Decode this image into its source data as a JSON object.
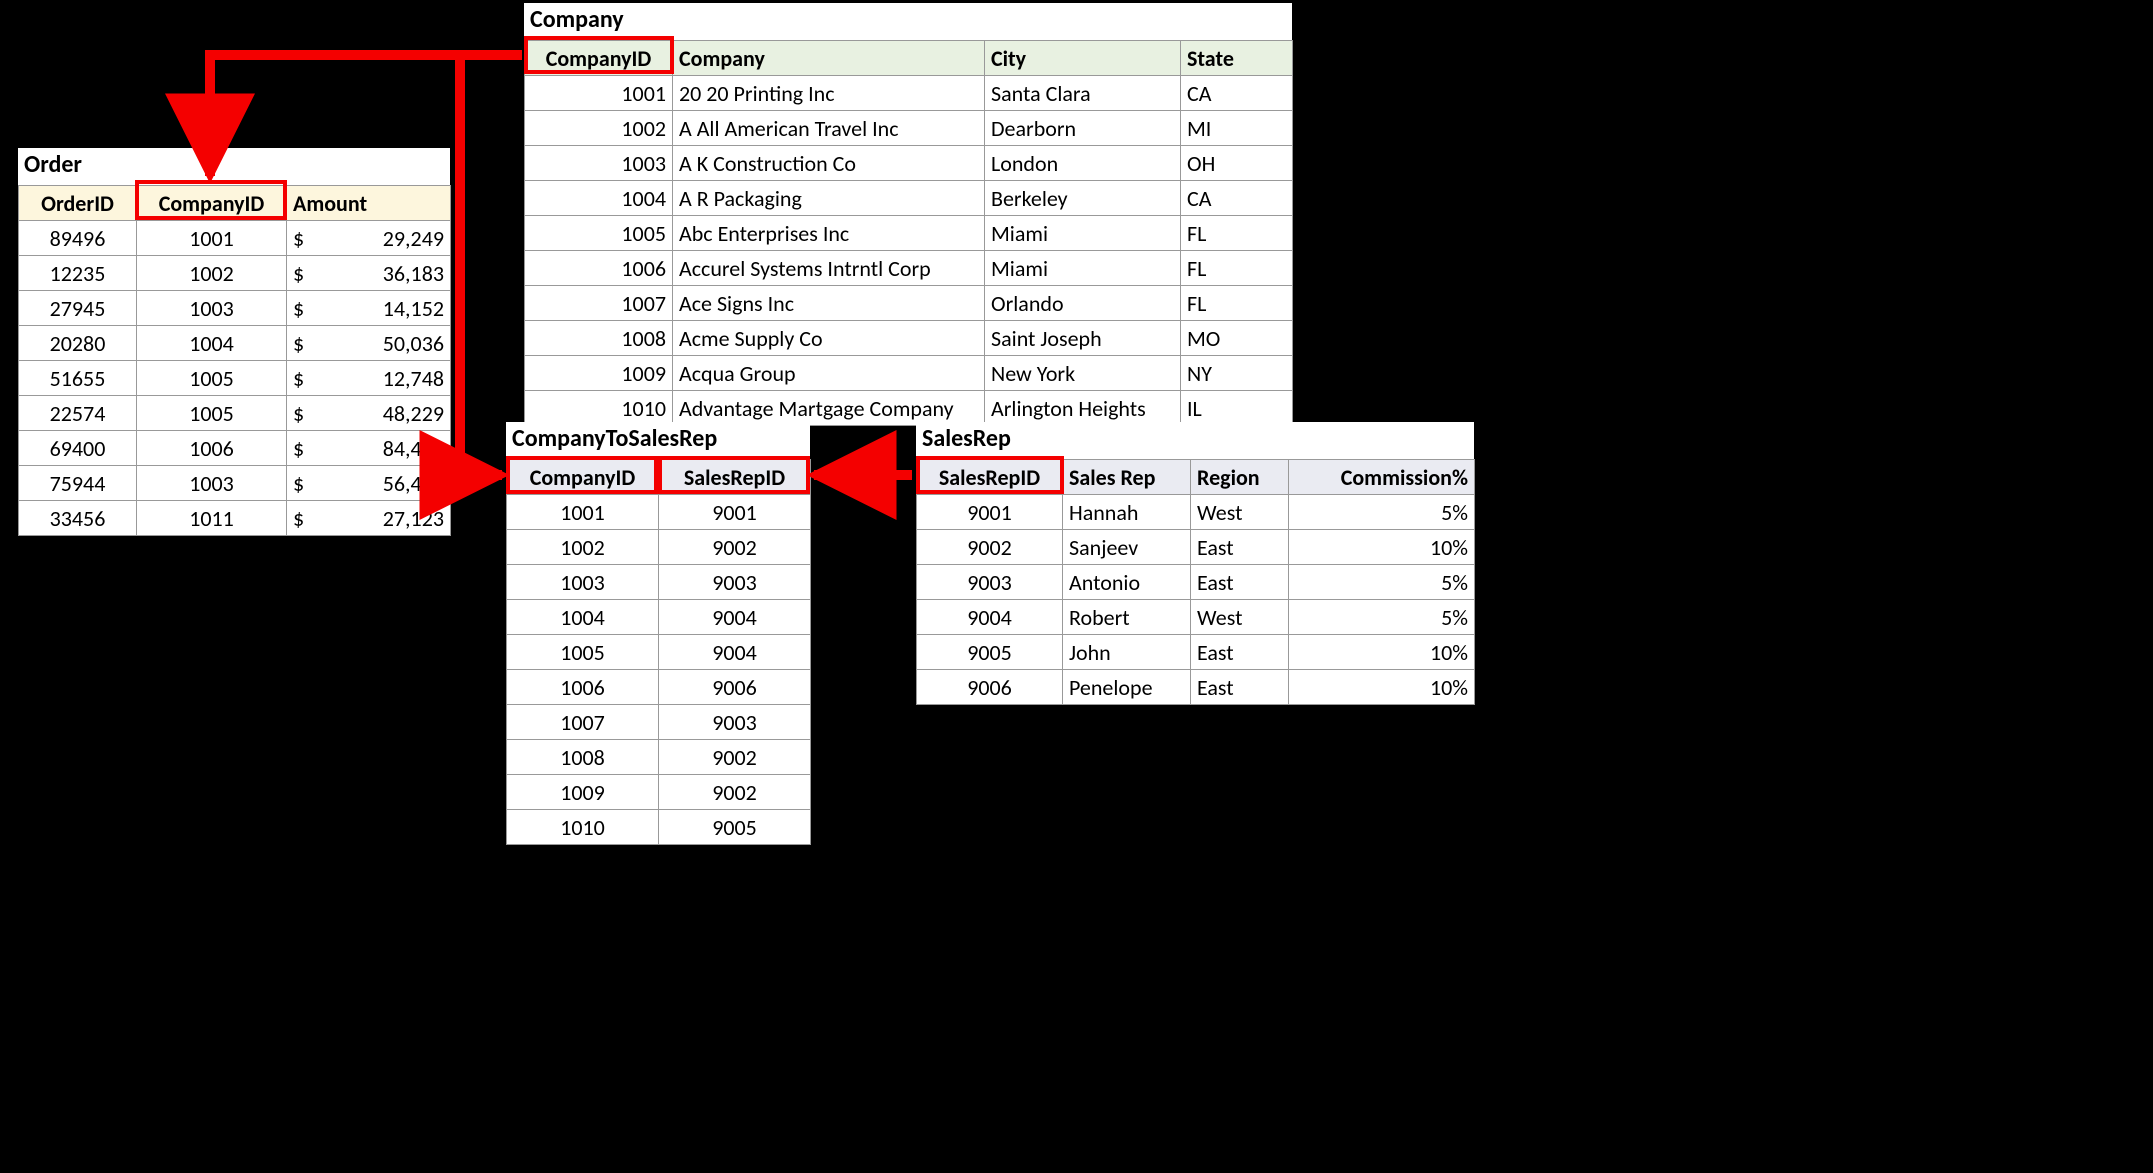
{
  "order": {
    "title": "Order",
    "headers": [
      "OrderID",
      "CompanyID",
      "Amount"
    ],
    "rows": [
      {
        "id": "89496",
        "company": "1001",
        "amount": "29,249"
      },
      {
        "id": "12235",
        "company": "1002",
        "amount": "36,183"
      },
      {
        "id": "27945",
        "company": "1003",
        "amount": "14,152"
      },
      {
        "id": "20280",
        "company": "1004",
        "amount": "50,036"
      },
      {
        "id": "51655",
        "company": "1005",
        "amount": "12,748"
      },
      {
        "id": "22574",
        "company": "1005",
        "amount": "48,229"
      },
      {
        "id": "69400",
        "company": "1006",
        "amount": "84,453"
      },
      {
        "id": "75944",
        "company": "1003",
        "amount": "56,425"
      },
      {
        "id": "33456",
        "company": "1011",
        "amount": "27,123"
      }
    ],
    "currency": "$"
  },
  "company": {
    "title": "Company",
    "headers": [
      "CompanyID",
      "Company",
      "City",
      "State"
    ],
    "rows": [
      {
        "id": "1001",
        "name": "20 20 Printing Inc",
        "city": "Santa Clara",
        "state": "CA"
      },
      {
        "id": "1002",
        "name": "A All American Travel Inc",
        "city": "Dearborn",
        "state": "MI"
      },
      {
        "id": "1003",
        "name": "A K Construction Co",
        "city": "London",
        "state": "OH"
      },
      {
        "id": "1004",
        "name": "A R Packaging",
        "city": "Berkeley",
        "state": "CA"
      },
      {
        "id": "1005",
        "name": "Abc Enterprises Inc",
        "city": "Miami",
        "state": "FL"
      },
      {
        "id": "1006",
        "name": "Accurel Systems Intrntl Corp",
        "city": "Miami",
        "state": "FL"
      },
      {
        "id": "1007",
        "name": "Ace Signs Inc",
        "city": "Orlando",
        "state": "FL"
      },
      {
        "id": "1008",
        "name": "Acme Supply Co",
        "city": "Saint Joseph",
        "state": "MO"
      },
      {
        "id": "1009",
        "name": "Acqua Group",
        "city": "New York",
        "state": "NY"
      },
      {
        "id": "1010",
        "name": "Advantage Martgage Company",
        "city": "Arlington Heights",
        "state": "IL"
      }
    ]
  },
  "map": {
    "title": "CompanyToSalesRep",
    "headers": [
      "CompanyID",
      "SalesRepID"
    ],
    "rows": [
      {
        "company": "1001",
        "rep": "9001"
      },
      {
        "company": "1002",
        "rep": "9002"
      },
      {
        "company": "1003",
        "rep": "9003"
      },
      {
        "company": "1004",
        "rep": "9004"
      },
      {
        "company": "1005",
        "rep": "9004"
      },
      {
        "company": "1006",
        "rep": "9006"
      },
      {
        "company": "1007",
        "rep": "9003"
      },
      {
        "company": "1008",
        "rep": "9002"
      },
      {
        "company": "1009",
        "rep": "9002"
      },
      {
        "company": "1010",
        "rep": "9005"
      }
    ]
  },
  "rep": {
    "title": "SalesRep",
    "headers": [
      "SalesRepID",
      "Sales Rep",
      "Region",
      "Commission%"
    ],
    "rows": [
      {
        "id": "9001",
        "name": "Hannah",
        "region": "West",
        "comm": "5%"
      },
      {
        "id": "9002",
        "name": "Sanjeev",
        "region": "East",
        "comm": "10%"
      },
      {
        "id": "9003",
        "name": "Antonio",
        "region": "East",
        "comm": "5%"
      },
      {
        "id": "9004",
        "name": "Robert",
        "region": "West",
        "comm": "5%"
      },
      {
        "id": "9005",
        "name": "John",
        "region": "East",
        "comm": "10%"
      },
      {
        "id": "9006",
        "name": "Penelope",
        "region": "East",
        "comm": "10%"
      }
    ]
  }
}
